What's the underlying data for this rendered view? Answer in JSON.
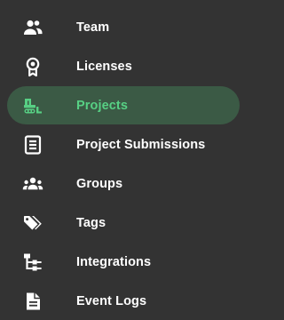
{
  "colors": {
    "background": "#333333",
    "text": "#ffffff",
    "active_background": "#3b5a45",
    "active_text": "#57d084"
  },
  "nav": {
    "items": [
      {
        "label": "Team",
        "icon": "team-icon",
        "active": false
      },
      {
        "label": "Licenses",
        "icon": "license-icon",
        "active": false
      },
      {
        "label": "Projects",
        "icon": "bulldozer-icon",
        "active": true
      },
      {
        "label": "Project Submissions",
        "icon": "document-list-icon",
        "active": false
      },
      {
        "label": "Groups",
        "icon": "groups-icon",
        "active": false
      },
      {
        "label": "Tags",
        "icon": "tags-icon",
        "active": false
      },
      {
        "label": "Integrations",
        "icon": "hierarchy-icon",
        "active": false
      },
      {
        "label": "Event Logs",
        "icon": "file-text-icon",
        "active": false
      }
    ]
  }
}
